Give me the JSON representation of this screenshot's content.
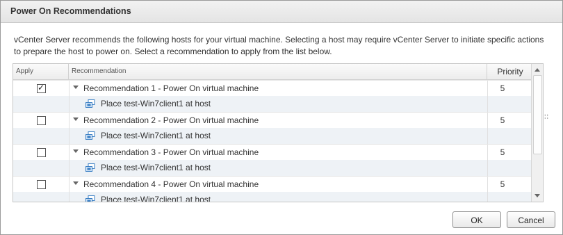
{
  "dialog": {
    "title": "Power On Recommendations",
    "description": "vCenter Server recommends the following hosts for your virtual machine. Selecting a host may require vCenter Server to initiate specific actions to prepare the host to power on. Select a recommendation to apply from the list below."
  },
  "grid": {
    "columns": [
      "Apply",
      "Recommendation",
      "Priority"
    ],
    "rows": [
      {
        "checked": true,
        "label": "Recommendation 1 - Power On virtual machine",
        "priority": "5",
        "child": "Place test-Win7client1 at host"
      },
      {
        "checked": false,
        "label": "Recommendation 2 - Power On virtual machine",
        "priority": "5",
        "child": "Place test-Win7client1 at host"
      },
      {
        "checked": false,
        "label": "Recommendation 3 - Power On virtual machine",
        "priority": "5",
        "child": "Place test-Win7client1 at host"
      },
      {
        "checked": false,
        "label": "Recommendation 4 - Power On virtual machine",
        "priority": "5",
        "child": "Place test-Win7client1 at host"
      }
    ]
  },
  "buttons": {
    "ok": "OK",
    "cancel": "Cancel"
  },
  "icons": {
    "caret": "expand-caret-icon",
    "vm": "virtual-machine-icon",
    "check": "checkmark-icon"
  },
  "colors": {
    "child_row_bg": "#eef2f6",
    "vm_icon": "#3a7fc4"
  }
}
